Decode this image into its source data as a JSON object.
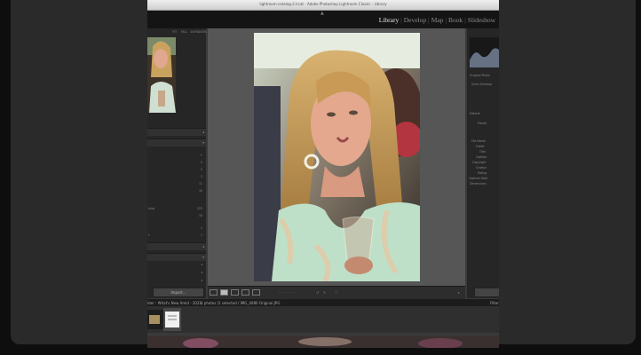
{
  "window": {
    "title": "lightroom-catalog-2.lrcat - Adobe Photoshop Lightroom Classic - Library"
  },
  "modules": [
    {
      "label": "Library",
      "active": true
    },
    {
      "label": "Develop",
      "active": false
    },
    {
      "label": "Map",
      "active": false
    },
    {
      "label": "Book",
      "active": false
    },
    {
      "label": "Slideshow",
      "active": false
    }
  ],
  "navigator": {
    "zoom_options": [
      "FIT",
      "FILL",
      "100%",
      "200%"
    ]
  },
  "left_panel": {
    "rows": [
      {
        "label": "",
        "value": "+"
      },
      {
        "label": "",
        "value": "2"
      },
      {
        "label": "",
        "value": "2"
      },
      {
        "label": "",
        "value": "2"
      },
      {
        "label": "",
        "value": "11"
      },
      {
        "label": "",
        "value": "10"
      },
      {
        "label": "hing",
        "value": "225"
      },
      {
        "label": "",
        "value": "10"
      },
      {
        "label": "",
        "value": "1"
      },
      {
        "label": "t",
        "value": "1"
      }
    ],
    "import_label": "Import..."
  },
  "right_panel": {
    "original_photo_label": "Original Photo",
    "quick_develop_label": "Quick Develop",
    "default_label": "Default",
    "preset_label": "Preset",
    "metadata_labels": [
      "File Name",
      "Folder",
      "Title",
      "Caption",
      "Copyright",
      "Creator",
      "Rating",
      "Capture Date",
      "Dimensions"
    ]
  },
  "filmstrip": {
    "source": "lder : What's New Amid - 2021",
    "selection": "4 photos /1 selected / IMG_4080 Original.JPG",
    "filter_label": "Filter"
  },
  "colors": {
    "accent": "#e6e6e6",
    "panel": "#262626",
    "background": "#565656"
  }
}
